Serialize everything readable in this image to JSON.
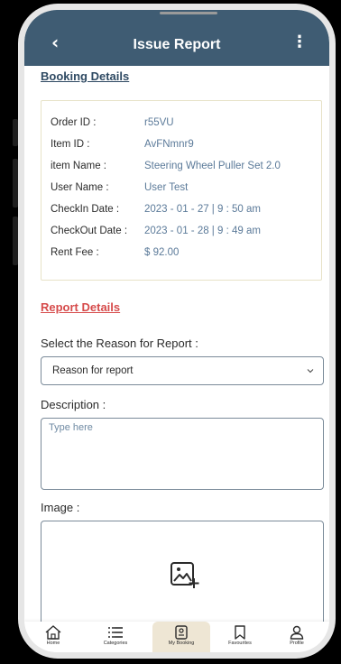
{
  "header": {
    "title": "Issue Report",
    "back_icon": "chevron-left-icon",
    "menu_icon": "more-vertical-icon"
  },
  "booking": {
    "section_title": "Booking Details",
    "rows": [
      {
        "key": "Order ID :",
        "value": "r55VU"
      },
      {
        "key": "Item ID :",
        "value": "AvFNmnr9"
      },
      {
        "key": "item Name :",
        "value": "Steering Wheel Puller Set 2.0"
      },
      {
        "key": "User Name :",
        "value": "User Test"
      },
      {
        "key": "CheckIn Date :",
        "value": "2023 - 01 - 27 | 9 : 50 am"
      },
      {
        "key": "CheckOut Date :",
        "value": "2023 - 01 - 28 | 9 : 49 am"
      },
      {
        "key": "Rent Fee :",
        "value": "$ 92.00"
      }
    ]
  },
  "report": {
    "section_title": "Report Details",
    "reason_label": "Select the Reason for Report :",
    "reason_value": "Reason for report",
    "description_label": "Description :",
    "description_placeholder": "Type here",
    "image_label": "Image :"
  },
  "nav": {
    "items": [
      {
        "label": "Home",
        "icon": "home-icon"
      },
      {
        "label": "Categories",
        "icon": "list-icon"
      },
      {
        "label": "My Booking",
        "icon": "booking-icon",
        "active": true
      },
      {
        "label": "Favourites",
        "icon": "bookmark-icon"
      },
      {
        "label": "Profile",
        "icon": "user-icon"
      }
    ]
  },
  "colors": {
    "appbar": "#3f5c73",
    "booking_title": "#2f4a63",
    "report_title": "#d64b4b",
    "value_text": "#5b7a99",
    "active_nav": "#eee6d4"
  }
}
